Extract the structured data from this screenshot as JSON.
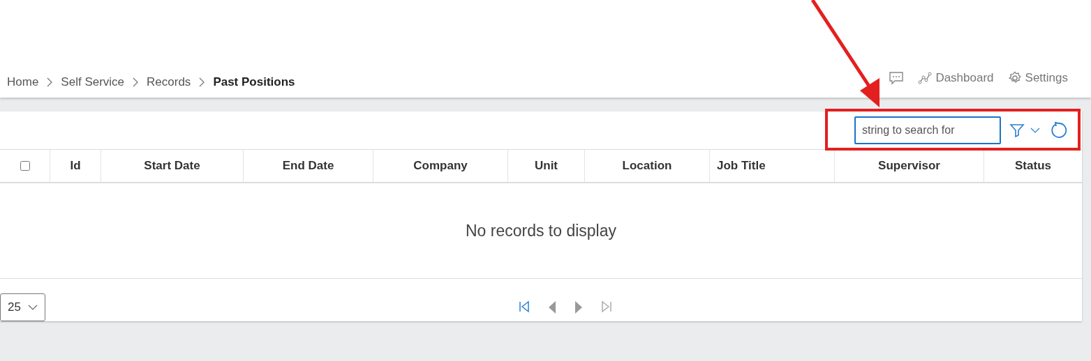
{
  "breadcrumb": [
    {
      "label": "Home",
      "current": false
    },
    {
      "label": "Self Service",
      "current": false
    },
    {
      "label": "Records",
      "current": false
    },
    {
      "label": "Past Positions",
      "current": true
    }
  ],
  "header_links": [
    {
      "kind": "chat"
    },
    {
      "kind": "dashboard",
      "label": "Dashboard"
    },
    {
      "kind": "settings",
      "label": "Settings"
    }
  ],
  "search": {
    "placeholder": "string to search for"
  },
  "table": {
    "select_all": {
      "checked": false
    },
    "columns": [
      {
        "label": "Id",
        "kind": "centered"
      },
      {
        "label": "Start Date",
        "kind": "centered"
      },
      {
        "label": "End Date",
        "kind": "centered"
      },
      {
        "label": "Company",
        "kind": "centered"
      },
      {
        "label": "Unit",
        "kind": "centered"
      },
      {
        "label": "Location",
        "kind": "centered"
      },
      {
        "label": "Job Title",
        "kind": "left"
      },
      {
        "label": "Supervisor",
        "kind": "centered"
      },
      {
        "label": "Status",
        "kind": "centered"
      }
    ],
    "empty_message": "No records to display"
  },
  "page_size": "25",
  "pager": [
    {
      "kind": "first",
      "disabled": false
    },
    {
      "kind": "prev",
      "disabled": false
    },
    {
      "kind": "next",
      "disabled": false
    },
    {
      "kind": "last",
      "disabled": true
    }
  ]
}
